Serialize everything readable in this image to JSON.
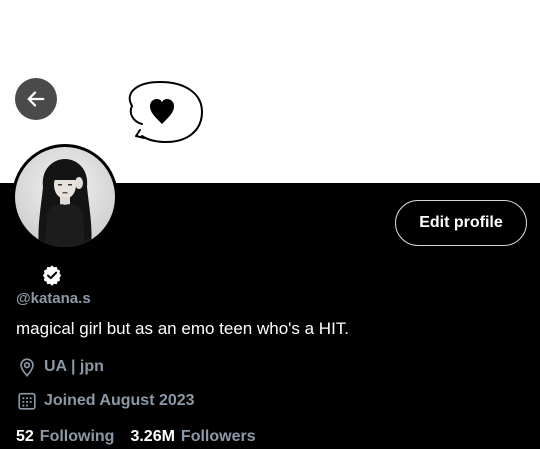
{
  "header": {
    "back_icon": "arrow-left-icon",
    "banner_art": "heart-speech-bubble-doodle"
  },
  "profile": {
    "avatar_icon": "profile-photo",
    "edit_button_label": "Edit profile",
    "verified_icon": "verified-badge-icon",
    "handle": "@katana.s",
    "bio": "magical girl but as an emo teen who's a HIT.",
    "location": "UA | jpn",
    "joined": "Joined August 2023",
    "following_count": "52",
    "following_label": "Following",
    "followers_count": "3.26M",
    "followers_label": "Followers"
  },
  "colors": {
    "background": "#000000",
    "banner": "#ffffff",
    "secondary_text": "#8b98a5",
    "primary_text": "#ffffff",
    "back_button": "#4a4a4a"
  }
}
